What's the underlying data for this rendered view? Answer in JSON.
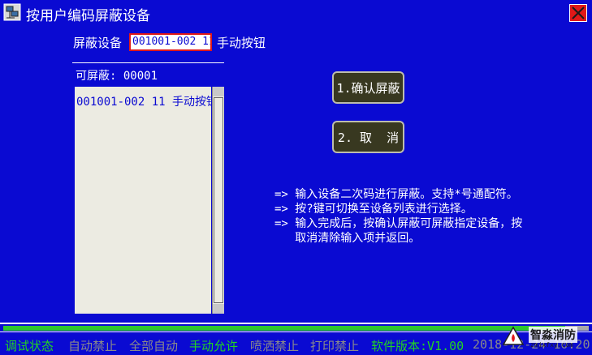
{
  "window": {
    "title": "按用户编码屏蔽设备",
    "icon": "network-computer-icon",
    "close_icon": "close-x-icon"
  },
  "form": {
    "label": "屏蔽设备",
    "input_value": "001001-002 11",
    "device_desc": "手动按钮"
  },
  "list": {
    "header": "可屏蔽: 00001",
    "items": [
      "001001-002 11 手动按钮"
    ]
  },
  "buttons": {
    "confirm": "1.确认屏蔽",
    "cancel": "2. 取  消"
  },
  "help": [
    "=> 输入设备二次码进行屏蔽。支持*号通配符。",
    "=> 按?键可切换至设备列表进行选择。",
    "=> 输入完成后，按确认屏蔽可屏蔽指定设备，按",
    "   取消清除输入项并返回。"
  ],
  "progress": {
    "fraction": 0.96
  },
  "status": {
    "debug": "调试状态",
    "auto_off": "自动禁止",
    "all_auto": "全部自动",
    "manual_on": "手动允许",
    "spray_off": "喷洒禁止",
    "print_off": "打印禁止",
    "version": "软件版本:V1.00",
    "datetime": "2018-12-24 10:20"
  },
  "watermark": {
    "name": "智淼消防",
    "url": "zmjxfxy.com"
  },
  "colors": {
    "background": "#0a0ad2",
    "status_green": "#22d422",
    "status_gray": "#8a8a8a",
    "input_border": "#e01818",
    "button_bg": "#383820"
  }
}
